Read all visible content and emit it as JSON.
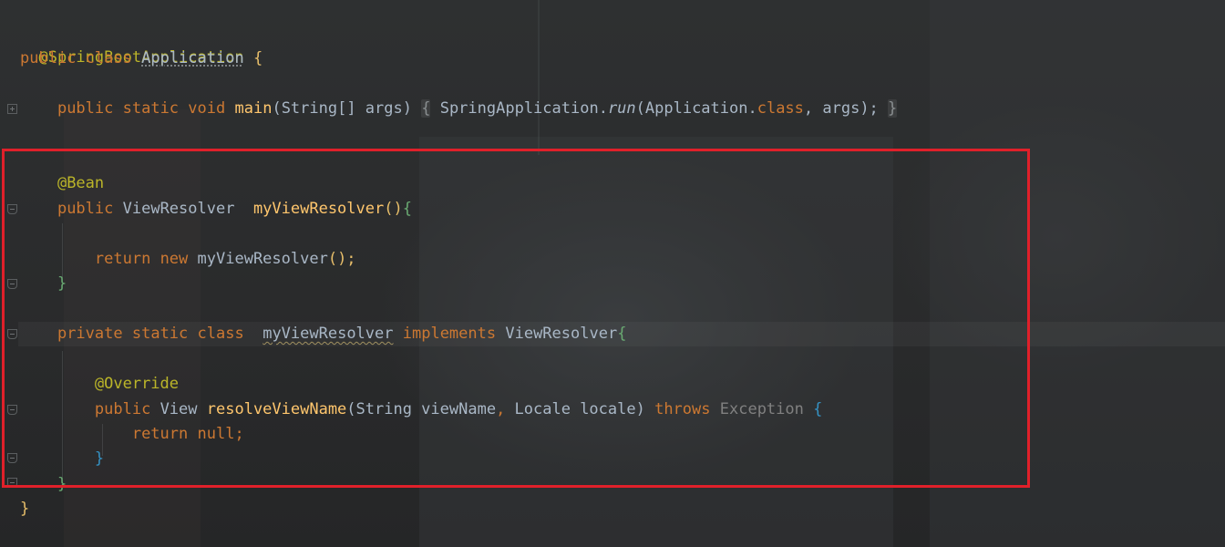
{
  "code": {
    "line1_annotation": "@SpringBootApplication",
    "line2": {
      "kw1": "public",
      "kw2": "class",
      "name": "Application",
      "brace": "{"
    },
    "line3": {
      "kw1": "public",
      "kw2": "static",
      "kw3": "void",
      "fn": "main",
      "params": "(String[] args) ",
      "open": "{",
      "call": " SpringApplication.",
      "run": "run",
      "args1": "(Application.",
      "classkw": "class",
      "args2": ", args);",
      "close": "}"
    },
    "line4_annotation": "@Bean",
    "line5": {
      "kw1": "public",
      "type": "ViewResolver",
      "fn": "myViewResolver",
      "parens": "()",
      "brace": "{"
    },
    "line6": {
      "kw1": "return",
      "kw2": "new",
      "call": "myViewResolver",
      "rest": "();"
    },
    "line7": {
      "brace": "}"
    },
    "line8": {
      "kw1": "private",
      "kw2": "static",
      "kw3": "class",
      "name": "myViewResolver",
      "kw4": "implements",
      "iface": "ViewResolver",
      "brace": "{"
    },
    "line9_annotation": "@Override",
    "line10": {
      "kw1": "public",
      "type": "View",
      "fn": "resolveViewName",
      "params1": "(String viewName",
      "comma": ",",
      "params2": " Locale locale) ",
      "kw2": "throws",
      "exc": "Exception",
      "brace": "{"
    },
    "line11": {
      "kw1": "return",
      "val": "null;"
    },
    "line12": {
      "brace": "}"
    },
    "line13": {
      "brace": "}"
    },
    "line14": {
      "brace": "}"
    }
  },
  "colors": {
    "background": "#2a2c2d",
    "keyword": "#cc7832",
    "annotation": "#bbb529",
    "function": "#ffc66d",
    "text": "#a9b7c6",
    "highlight_box": "#e0202a"
  }
}
